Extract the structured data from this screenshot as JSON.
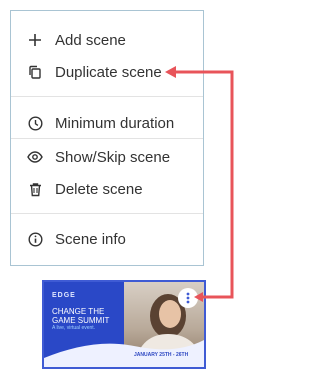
{
  "menu": {
    "items": [
      {
        "label": "Add scene",
        "icon": "plus-icon"
      },
      {
        "label": "Duplicate scene",
        "icon": "copy-icon"
      },
      {
        "label": "Minimum duration",
        "icon": "clock-icon"
      },
      {
        "label": "Show/Skip scene",
        "icon": "eye-icon"
      },
      {
        "label": "Delete scene",
        "icon": "trash-icon"
      },
      {
        "label": "Scene info",
        "icon": "info-icon"
      }
    ]
  },
  "thumbnail": {
    "brand": "EDGE",
    "title": "CHANGE THE GAME SUMMIT",
    "subtitle": "A live, virtual event.",
    "date": "JANUARY 25TH - 26TH"
  },
  "colors": {
    "arrow": "#e8545a",
    "menu_border": "#a9c4d3",
    "thumbnail_bg": "#2a48c7",
    "thumbnail_border": "#3f5bd4"
  }
}
